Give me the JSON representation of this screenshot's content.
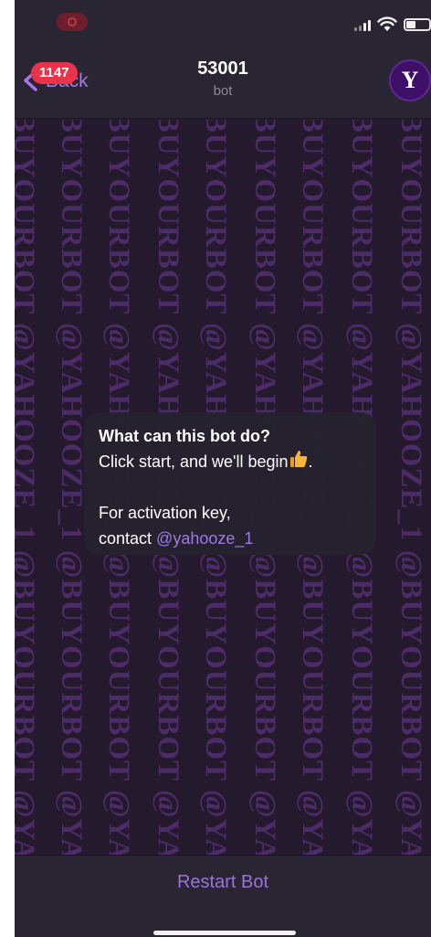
{
  "status_bar": {
    "icons": [
      "record-icon",
      "cellular-signal-icon",
      "wifi-icon",
      "battery-icon"
    ]
  },
  "nav": {
    "back_label": "Back",
    "unread_count": "1147",
    "title": "53001",
    "subtitle": "bot",
    "avatar_letter": "Y"
  },
  "wallpaper": {
    "text": "@BUYOURBOT @YAHOOZE_1 @BUYOURBOT @YAHOOZE_1 @BUYOURB"
  },
  "card": {
    "title": "What can this bot do?",
    "line1": "Click start, and we'll begin",
    "line1_end": ".",
    "line2": "For activation key,",
    "line3_prefix": "contact ",
    "mention": "@yahooze_1"
  },
  "bottom": {
    "restart_label": "Restart Bot"
  },
  "colors": {
    "accent": "#a777e6",
    "badge": "#e9334a",
    "background": "#26202e",
    "wallpaper_text": "#4b2c66"
  }
}
